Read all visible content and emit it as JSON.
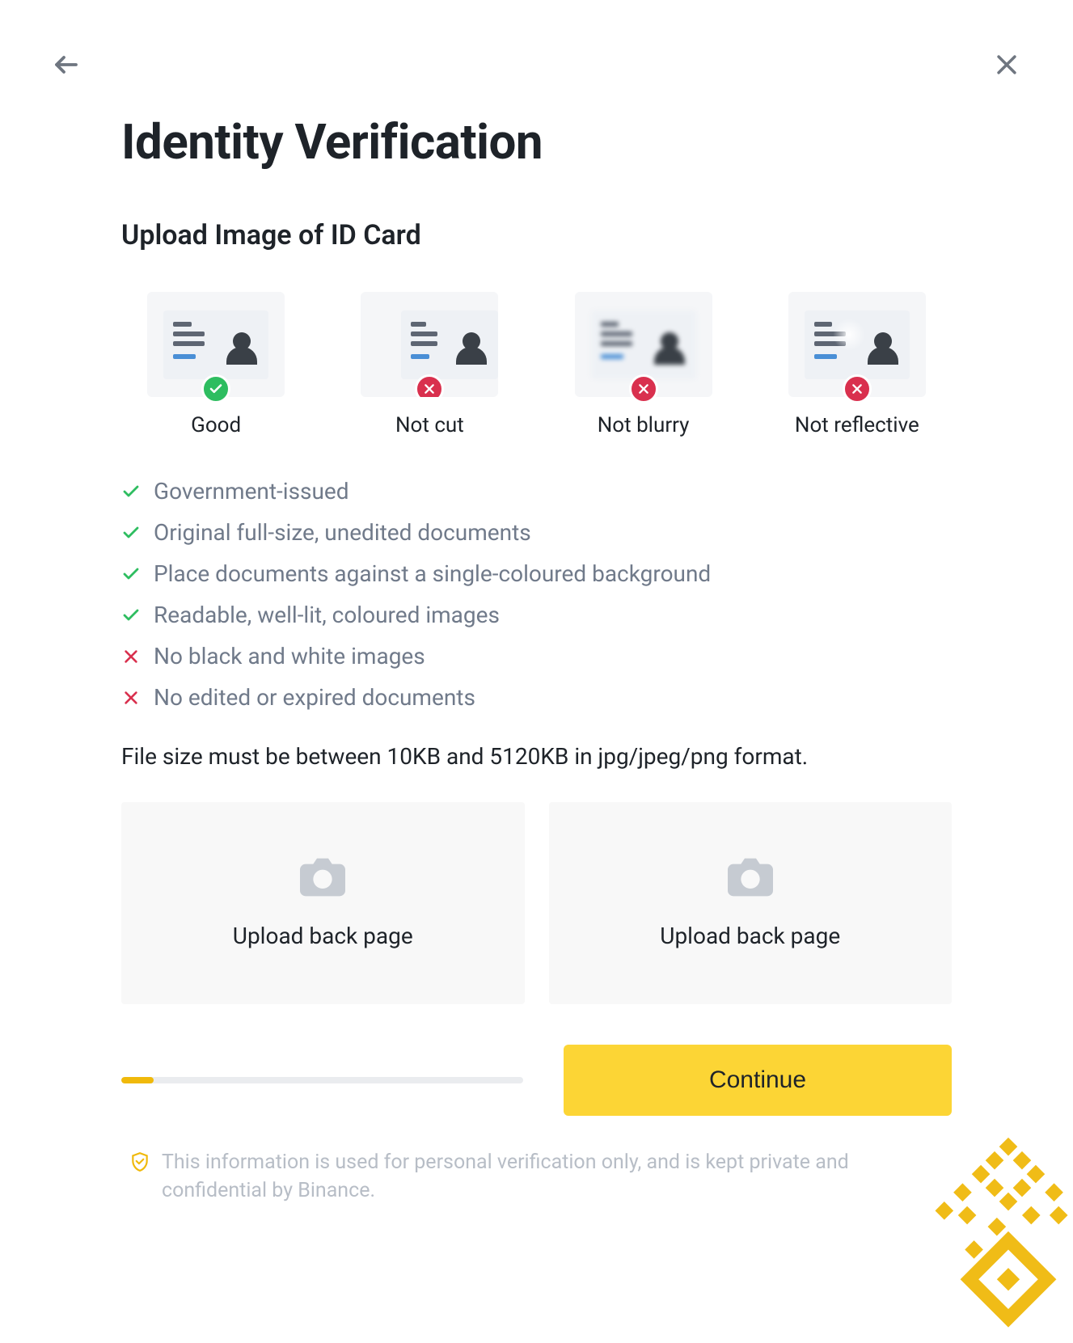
{
  "header": {
    "title": "Identity Verification",
    "subtitle": "Upload Image of ID Card"
  },
  "examples": [
    {
      "label": "Good",
      "status": "good"
    },
    {
      "label": "Not cut",
      "status": "bad"
    },
    {
      "label": "Not blurry",
      "status": "bad"
    },
    {
      "label": "Not reflective",
      "status": "bad"
    }
  ],
  "rules": [
    {
      "ok": true,
      "text": "Government-issued"
    },
    {
      "ok": true,
      "text": "Original full-size, unedited documents"
    },
    {
      "ok": true,
      "text": "Place documents against a single-coloured background"
    },
    {
      "ok": true,
      "text": "Readable, well-lit, coloured images"
    },
    {
      "ok": false,
      "text": "No black and white images"
    },
    {
      "ok": false,
      "text": "No edited or expired documents"
    }
  ],
  "file_note": "File size must be between 10KB and 5120KB in jpg/jpeg/png format.",
  "uploads": {
    "left_label": "Upload back page",
    "right_label": "Upload back page"
  },
  "progress_percent": 8,
  "continue_label": "Continue",
  "disclaimer": "This information is used for personal verification only, and is kept private and confidential by Binance."
}
